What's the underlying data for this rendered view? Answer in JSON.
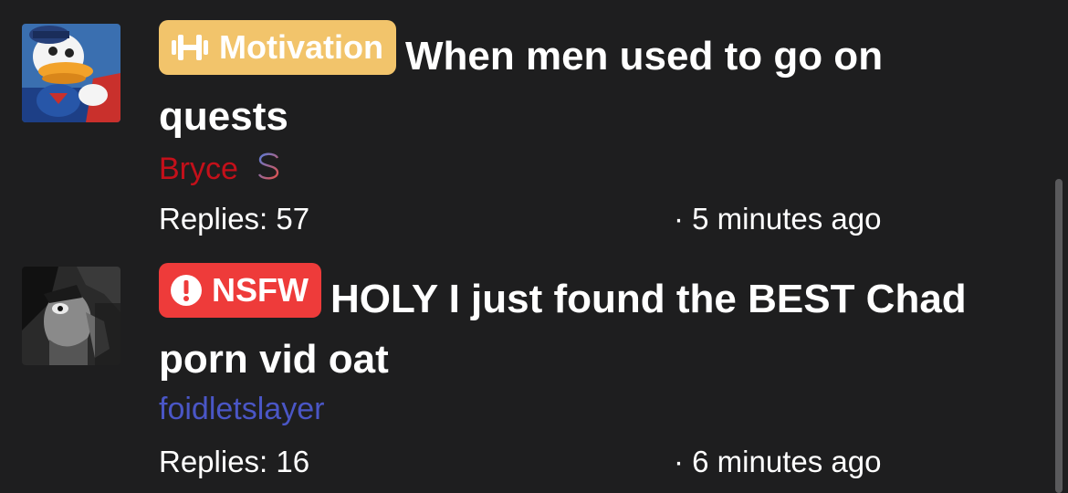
{
  "threads": [
    {
      "avatar_icon": "cartoon-duck-avatar",
      "tag": {
        "label": "Motivation",
        "icon": "dumbbell-icon",
        "color": "#f2c46b"
      },
      "title": "When men used to go on quests",
      "author": {
        "name": "Bryce",
        "color": "#c3101a",
        "badge_icon": "dollar-icon"
      },
      "replies": "Replies: 57",
      "time": "· 5 minutes ago"
    },
    {
      "avatar_icon": "manga-face-avatar",
      "tag": {
        "label": "NSFW",
        "icon": "exclamation-circle-icon",
        "color": "#ee3b3a"
      },
      "title": "HOLY I just found the BEST Chad porn vid oat",
      "author": {
        "name": "foidletslayer",
        "color": "#4a56c6"
      },
      "replies": "Replies: 16",
      "time": "· 6 minutes ago"
    }
  ]
}
